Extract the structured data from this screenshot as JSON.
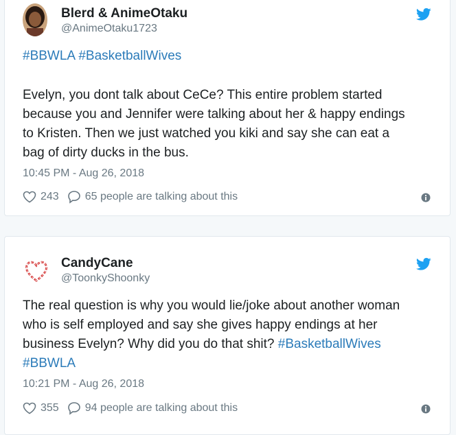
{
  "tweets": [
    {
      "user_name": "Blerd & AnimeOtaku",
      "handle": "@AnimeOtaku1723",
      "hashtags": [
        "#BBWLA",
        "#BasketballWives"
      ],
      "text_lines": [
        "Evelyn, you dont talk about CeCe? This entire problem started",
        "because you and Jennifer were talking about her & happy endings",
        "to Kristen. Then we just watched you kiki and say she can eat a",
        "bag of dirty ducks in the bus."
      ],
      "timestamp": "10:45 PM - Aug 26, 2018",
      "likes": "243",
      "talking": "65 people are talking about this"
    },
    {
      "user_name": "CandyCane",
      "handle": "@ToonkyShoonky",
      "text_lines": [
        "The real question is why you would lie/joke about another woman",
        "who is self employed and say she gives happy endings at her",
        "business Evelyn? Why did you do that shit? ",
        "#BBWLA"
      ],
      "inline_hashtag": "#BasketballWives",
      "timestamp": "10:21 PM - Aug 26, 2018",
      "likes": "355",
      "talking": "94 people are talking about this"
    }
  ],
  "icons": {
    "bird": "twitter-bird-icon",
    "like": "heart-icon",
    "reply": "speech-bubble-icon",
    "info": "info-icon"
  },
  "colors": {
    "accent": "#1da1f2",
    "hashtag": "#2b7bb9",
    "muted": "#697882",
    "text": "#1c2022"
  }
}
